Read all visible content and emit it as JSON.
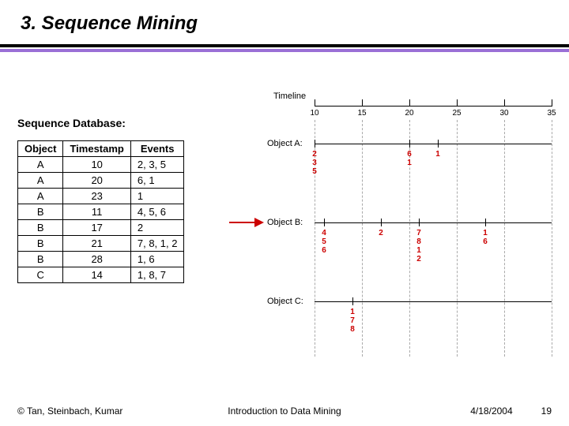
{
  "title": "3. Sequence Mining",
  "subtitle": "Sequence Database:",
  "table": {
    "headers": [
      "Object",
      "Timestamp",
      "Events"
    ],
    "rows": [
      {
        "object": "A",
        "timestamp": "10",
        "events": "2, 3, 5"
      },
      {
        "object": "A",
        "timestamp": "20",
        "events": "6, 1"
      },
      {
        "object": "A",
        "timestamp": "23",
        "events": "1"
      },
      {
        "object": "B",
        "timestamp": "11",
        "events": "4, 5, 6"
      },
      {
        "object": "B",
        "timestamp": "17",
        "events": "2"
      },
      {
        "object": "B",
        "timestamp": "21",
        "events": "7, 8, 1, 2"
      },
      {
        "object": "B",
        "timestamp": "28",
        "events": "1, 6"
      },
      {
        "object": "C",
        "timestamp": "14",
        "events": "1, 8, 7"
      }
    ]
  },
  "timeline": {
    "title": "Timeline",
    "ticks": [
      10,
      15,
      20,
      25,
      30,
      35
    ],
    "objects": [
      {
        "label": "Object A:",
        "marks": [
          {
            "t": 10,
            "events": [
              "2",
              "3",
              "5"
            ]
          },
          {
            "t": 20,
            "events": [
              "6",
              "1"
            ]
          },
          {
            "t": 23,
            "events": [
              "1"
            ]
          }
        ]
      },
      {
        "label": "Object B:",
        "marks": [
          {
            "t": 11,
            "events": [
              "4",
              "5",
              "6"
            ]
          },
          {
            "t": 17,
            "events": [
              "2"
            ]
          },
          {
            "t": 21,
            "events": [
              "7",
              "8",
              "1",
              "2"
            ]
          },
          {
            "t": 28,
            "events": [
              "1",
              "6"
            ]
          }
        ]
      },
      {
        "label": "Object C:",
        "marks": [
          {
            "t": 14,
            "events": [
              "1",
              "7",
              "8"
            ]
          }
        ]
      }
    ]
  },
  "footer": {
    "left": "© Tan, Steinbach, Kumar",
    "center": "Introduction to Data Mining",
    "date": "4/18/2004",
    "page": "19"
  },
  "chart_data": {
    "type": "table",
    "title": "Sequence Database",
    "columns": [
      "Object",
      "Timestamp",
      "Events"
    ],
    "rows": [
      [
        "A",
        10,
        [
          2,
          3,
          5
        ]
      ],
      [
        "A",
        20,
        [
          6,
          1
        ]
      ],
      [
        "A",
        23,
        [
          1
        ]
      ],
      [
        "B",
        11,
        [
          4,
          5,
          6
        ]
      ],
      [
        "B",
        17,
        [
          2
        ]
      ],
      [
        "B",
        21,
        [
          7,
          8,
          1,
          2
        ]
      ],
      [
        "B",
        28,
        [
          1,
          6
        ]
      ],
      [
        "C",
        14,
        [
          1,
          8,
          7
        ]
      ]
    ],
    "timeline_range": [
      10,
      35
    ]
  }
}
